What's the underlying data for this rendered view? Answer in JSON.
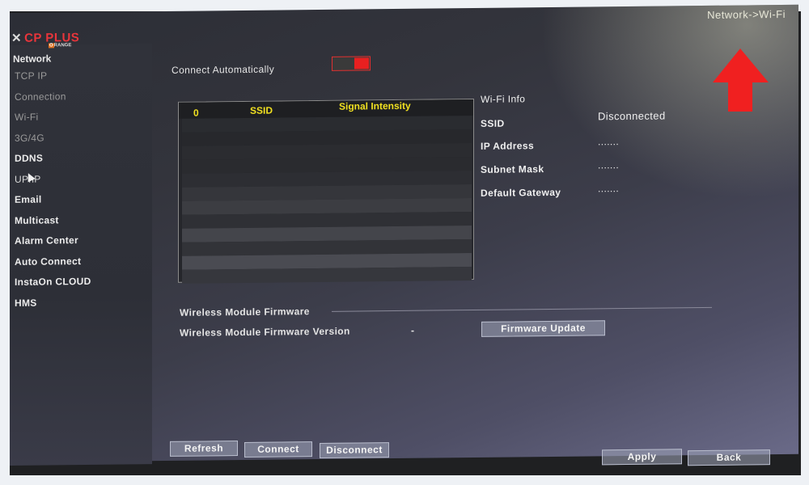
{
  "logo": {
    "brand": "CP PLUS",
    "sub": "RANGE",
    "sub_prefix": "O"
  },
  "breadcrumb": "Network->Wi-Fi",
  "sidebar": {
    "section_title": "Network",
    "items": [
      {
        "label": "TCP IP"
      },
      {
        "label": "Connection"
      },
      {
        "label": "Wi-Fi"
      },
      {
        "label": "3G/4G"
      },
      {
        "label": "DDNS"
      },
      {
        "label": "UPnP"
      },
      {
        "label": "Email"
      },
      {
        "label": "Multicast"
      },
      {
        "label": "Alarm Center"
      },
      {
        "label": "Auto Connect"
      },
      {
        "label": "InstaOn CLOUD"
      },
      {
        "label": "HMS"
      }
    ]
  },
  "connect_automatically": {
    "label": "Connect Automatically",
    "enabled": true
  },
  "wifi_list": {
    "columns": {
      "index": "0",
      "ssid": "SSID",
      "signal": "Signal Intensity"
    },
    "rows": []
  },
  "wifi_info": {
    "title": "Wi-Fi Info",
    "fields": [
      {
        "label": "SSID",
        "value": "Disconnected"
      },
      {
        "label": "IP Address",
        "value": "......."
      },
      {
        "label": "Subnet Mask",
        "value": "......."
      },
      {
        "label": "Default Gateway",
        "value": "......."
      }
    ]
  },
  "firmware": {
    "section_title": "Wireless Module Firmware",
    "version_label": "Wireless Module Firmware Version",
    "version_value": "-",
    "update_button": "Firmware Update"
  },
  "buttons": {
    "refresh": "Refresh",
    "connect": "Connect",
    "disconnect": "Disconnect",
    "apply": "Apply",
    "back": "Back"
  },
  "colors": {
    "accent_red": "#e82020",
    "header_yellow": "#f0e020",
    "annotation_arrow": "#f02020"
  }
}
